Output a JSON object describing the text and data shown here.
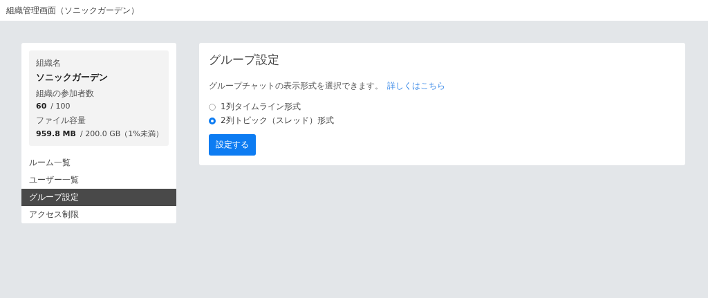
{
  "header": {
    "title": "組織管理画面（ソニックガーデン）"
  },
  "org": {
    "name_label": "組織名",
    "name": "ソニックガーデン",
    "members_label": "組織の参加者数",
    "members_value": "60",
    "members_limit": "/ 100",
    "storage_label": "ファイル容量",
    "storage_value": "959.8 MB",
    "storage_limit": "/ 200.0 GB（1%未満）"
  },
  "nav": [
    {
      "label": "ルーム一覧",
      "selected": false
    },
    {
      "label": "ユーザー一覧",
      "selected": false
    },
    {
      "label": "グループ設定",
      "selected": true
    },
    {
      "label": "アクセス制限",
      "selected": false
    }
  ],
  "panel": {
    "title": "グループ設定",
    "description": "グループチャットの表示形式を選択できます。",
    "link": "詳しくはこちら",
    "options": [
      {
        "label": "1列タイムライン形式",
        "selected": false
      },
      {
        "label": "2列トピック（スレッド）形式",
        "selected": true
      }
    ],
    "submit": "設定する"
  }
}
